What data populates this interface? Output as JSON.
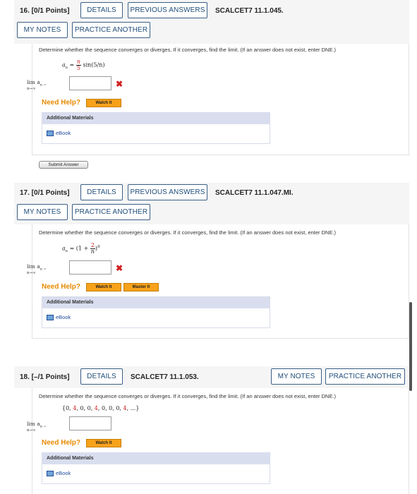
{
  "questions": [
    {
      "title": "16.  [0/1 Points]",
      "details_label": "DETAILS",
      "previous_label": "PREVIOUS ANSWERS",
      "reference": "SCALCET7 11.1.045.",
      "my_notes_label": "MY NOTES",
      "practice_label": "PRACTICE ANOTHER",
      "prompt": "Determine whether the sequence converges or diverges. If it converges, find the limit. (If an answer does not exist, enter DNE.)",
      "formula_lhs": "a",
      "formula_sub": "n",
      "formula_eq": " = ",
      "formula_num": "n",
      "formula_den": "5",
      "formula_rest": " sin(5/n)",
      "lim_label": "lim  a",
      "lim_sub": "n→∞",
      "lim_eq": "n =",
      "answer_value": "",
      "wrong_mark": "✖",
      "need_help": "Need Help?",
      "watch_label": "Watch It",
      "addl_title": "Additional Materials",
      "ebook_label": "eBook",
      "submit_label": "Submit Answer"
    },
    {
      "title": "17.  [0/1 Points]",
      "details_label": "DETAILS",
      "previous_label": "PREVIOUS ANSWERS",
      "reference": "SCALCET7 11.1.047.MI.",
      "my_notes_label": "MY NOTES",
      "practice_label": "PRACTICE ANOTHER",
      "prompt": "Determine whether the sequence converges or diverges. If it converges, find the limit. (If an answer does not exist, enter DNE.)",
      "formula_text": "= (1 + ",
      "formula_num": "2",
      "formula_den": "n",
      "formula_close": ")",
      "formula_exp": "n",
      "lim_label": "lim  a",
      "lim_sub": "n→∞",
      "lim_eq": "n =",
      "answer_value": "",
      "wrong_mark": "✖",
      "need_help": "Need Help?",
      "watch_label": "Watch It",
      "master_label": "Master It",
      "addl_title": "Additional Materials",
      "ebook_label": "eBook"
    },
    {
      "title": "18.  [–/1 Points]",
      "details_label": "DETAILS",
      "reference": "SCALCET7 11.1.053.",
      "my_notes_label": "MY NOTES",
      "practice_label": "PRACTICE ANOTHER",
      "prompt": "Determine whether the sequence converges or diverges. If it converges, find the limit. (If an answer does not exist, enter DNE.)",
      "sequence_open": "{0, ",
      "sequence_red1": "4",
      "sequence_mid1": ", 0, 0, ",
      "sequence_red2": "4",
      "sequence_mid2": ", 0, 0, 0, ",
      "sequence_red3": "4",
      "sequence_close": ", ...}",
      "lim_label": "lim  a",
      "lim_sub": "n→∞",
      "lim_eq": "n =",
      "answer_value": "",
      "need_help": "Need Help?",
      "watch_label": "Watch It",
      "addl_title": "Additional Materials",
      "ebook_label": "eBook"
    }
  ],
  "colors": {
    "button_border": "#3b5f86",
    "button_text": "#1f4d7a",
    "need_help": "#e68a00",
    "watch_button": "#f7a21a",
    "wrong_mark": "#d21f1f",
    "addl_header": "#d9deef"
  }
}
